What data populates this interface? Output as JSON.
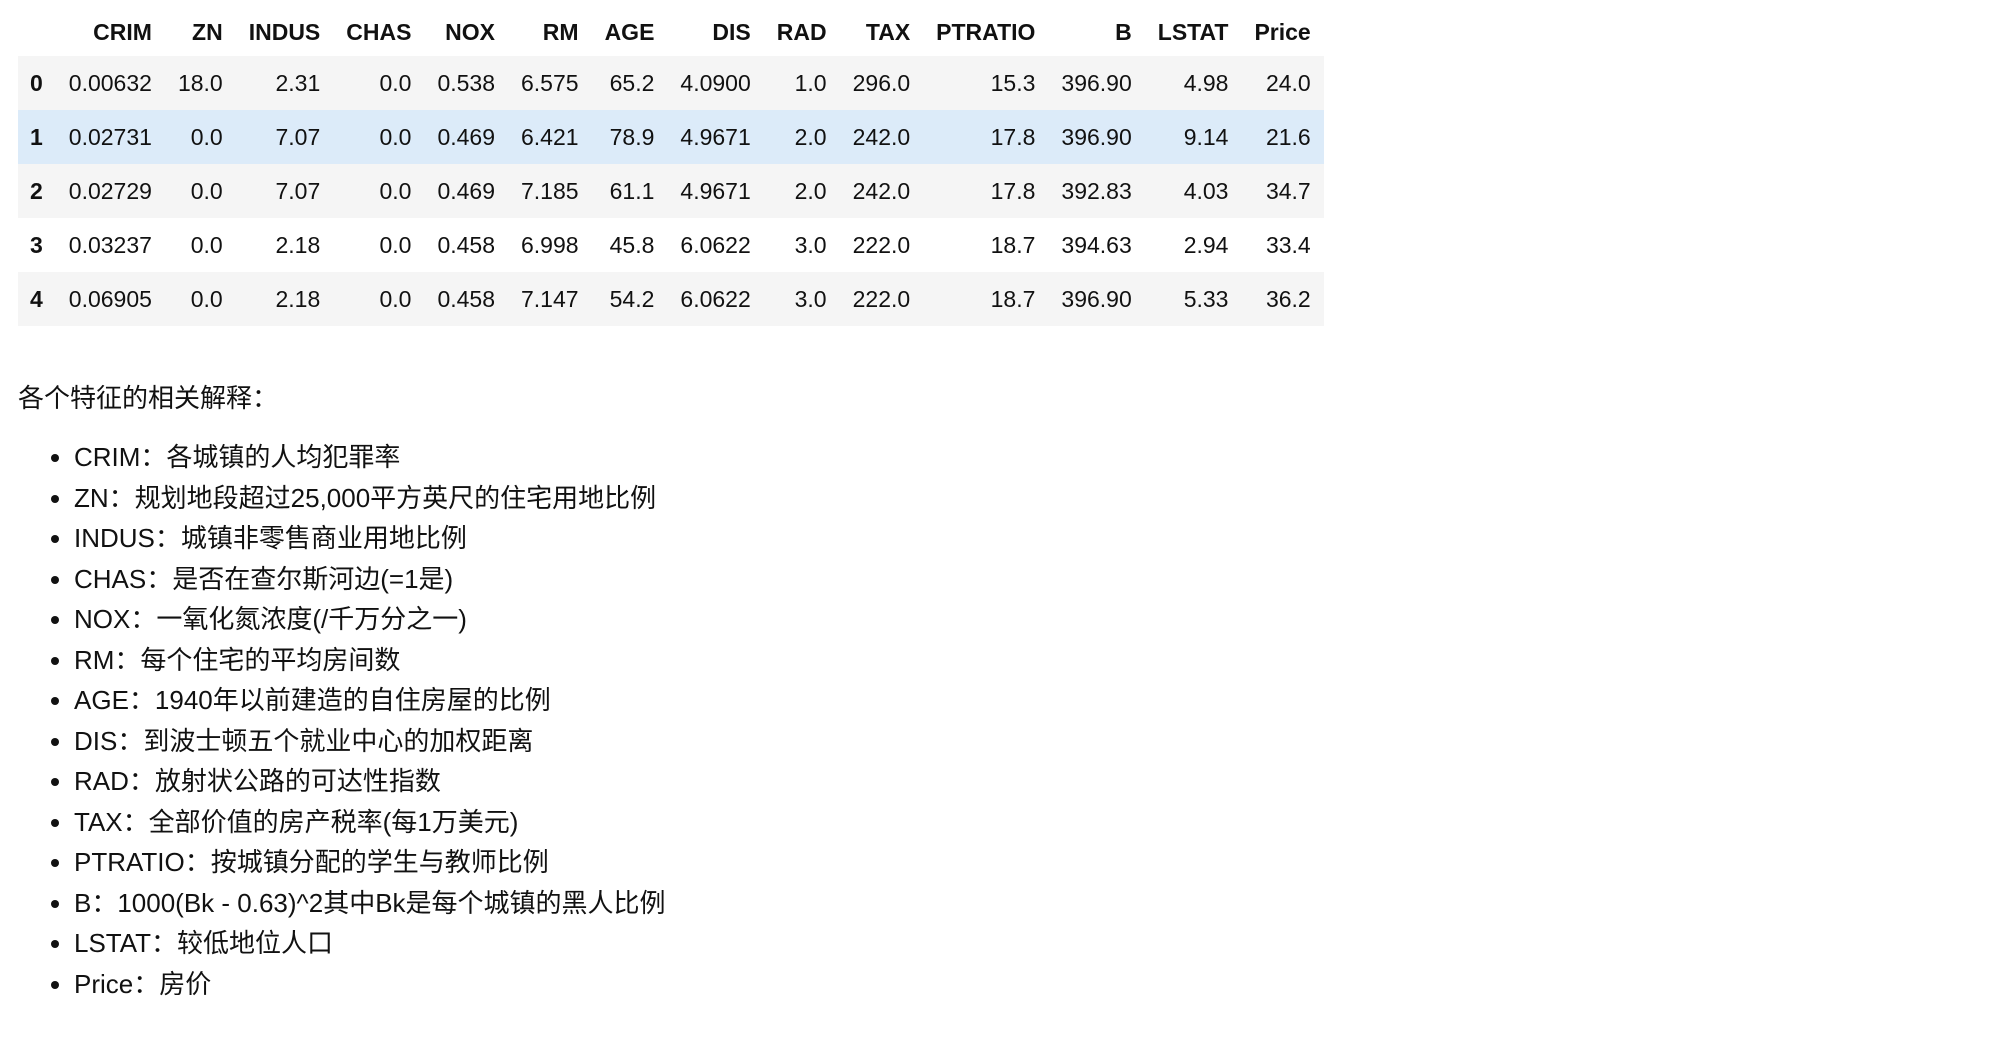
{
  "table": {
    "columns": [
      "CRIM",
      "ZN",
      "INDUS",
      "CHAS",
      "NOX",
      "RM",
      "AGE",
      "DIS",
      "RAD",
      "TAX",
      "PTRATIO",
      "B",
      "LSTAT",
      "Price"
    ],
    "rows": [
      {
        "index": "0",
        "cells": [
          "0.00632",
          "18.0",
          "2.31",
          "0.0",
          "0.538",
          "6.575",
          "65.2",
          "4.0900",
          "1.0",
          "296.0",
          "15.3",
          "396.90",
          "4.98",
          "24.0"
        ]
      },
      {
        "index": "1",
        "cells": [
          "0.02731",
          "0.0",
          "7.07",
          "0.0",
          "0.469",
          "6.421",
          "78.9",
          "4.9671",
          "2.0",
          "242.0",
          "17.8",
          "396.90",
          "9.14",
          "21.6"
        ]
      },
      {
        "index": "2",
        "cells": [
          "0.02729",
          "0.0",
          "7.07",
          "0.0",
          "0.469",
          "7.185",
          "61.1",
          "4.9671",
          "2.0",
          "242.0",
          "17.8",
          "392.83",
          "4.03",
          "34.7"
        ]
      },
      {
        "index": "3",
        "cells": [
          "0.03237",
          "0.0",
          "2.18",
          "0.0",
          "0.458",
          "6.998",
          "45.8",
          "6.0622",
          "3.0",
          "222.0",
          "18.7",
          "394.63",
          "2.94",
          "33.4"
        ]
      },
      {
        "index": "4",
        "cells": [
          "0.06905",
          "0.0",
          "2.18",
          "0.0",
          "0.458",
          "7.147",
          "54.2",
          "6.0622",
          "3.0",
          "222.0",
          "18.7",
          "396.90",
          "5.33",
          "36.2"
        ]
      }
    ]
  },
  "intro": "各个特征的相关解释：",
  "features": [
    "CRIM：各城镇的人均犯罪率",
    "ZN：规划地段超过25,000平方英尺的住宅用地比例",
    "INDUS：城镇非零售商业用地比例",
    "CHAS：是否在查尔斯河边(=1是)",
    "NOX：一氧化氮浓度(/千万分之一)",
    "RM：每个住宅的平均房间数",
    "AGE：1940年以前建造的自住房屋的比例",
    "DIS：到波士顿五个就业中心的加权距离",
    "RAD：放射状公路的可达性指数",
    "TAX：全部价值的房产税率(每1万美元)",
    "PTRATIO：按城镇分配的学生与教师比例",
    "B：1000(Bk - 0.63)^2其中Bk是每个城镇的黑人比例",
    "LSTAT：较低地位人口",
    "Price：房价"
  ],
  "colors": {
    "row_stripe": "#f5f5f5",
    "row_hover": "#dcebf9"
  }
}
